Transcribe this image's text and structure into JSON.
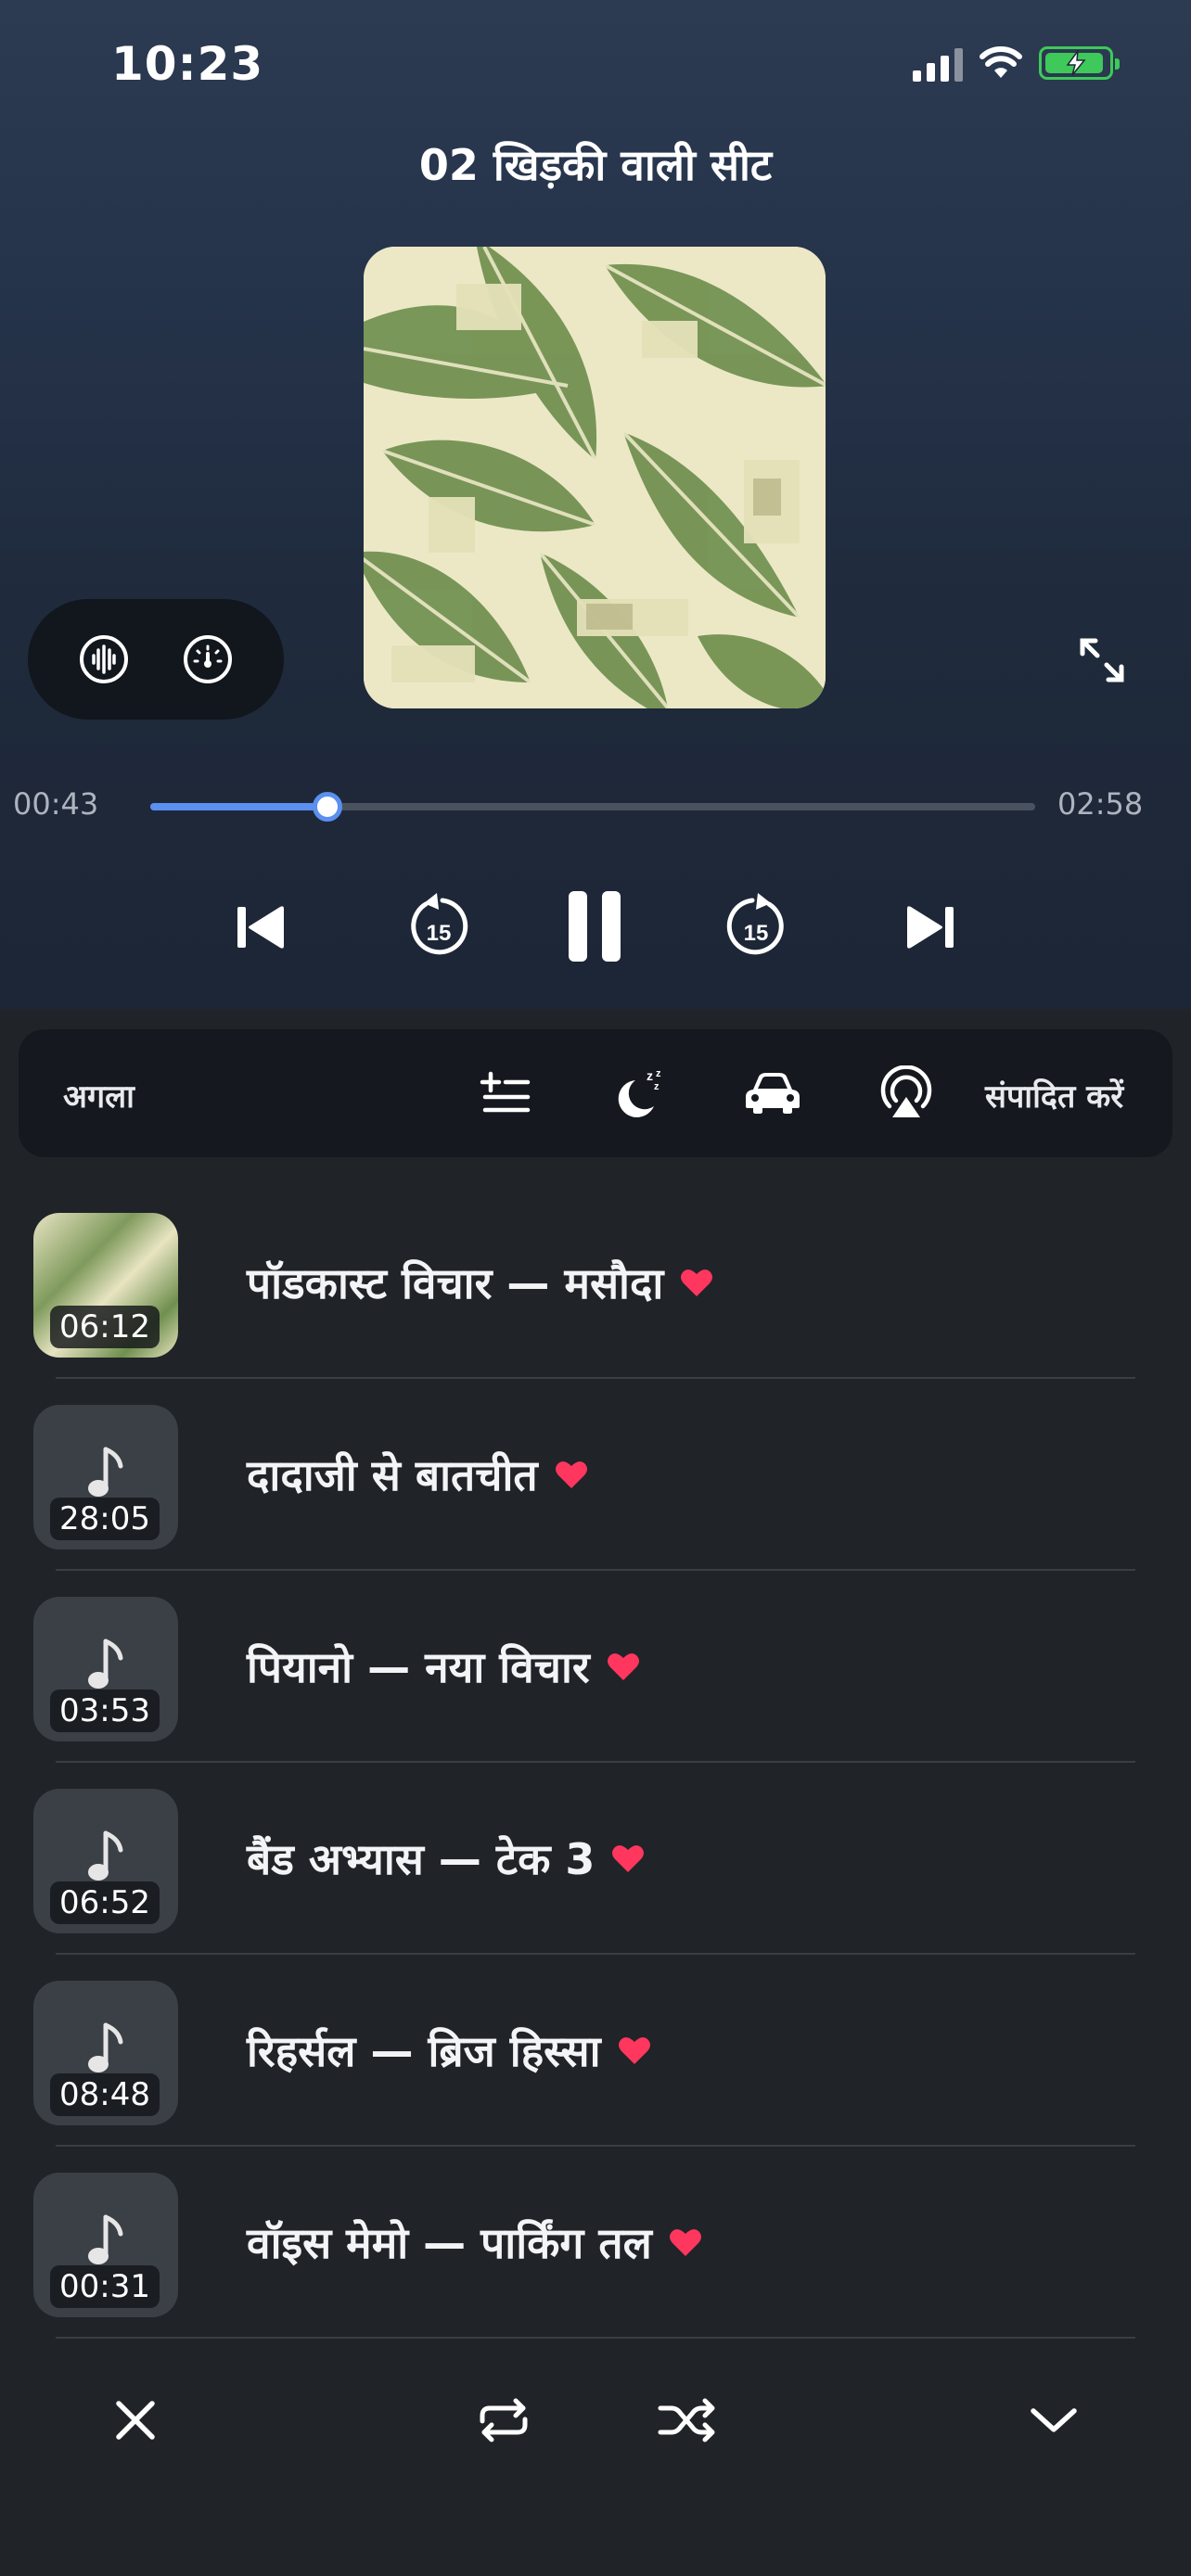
{
  "status_bar": {
    "time": "10:23",
    "battery_color": "#3ec95a"
  },
  "player": {
    "title": "02 खिड़की वाली सीट",
    "current_time": "00:43",
    "total_time": "02:58",
    "progress_fraction": 0.2,
    "accent_color": "#5b8ff0",
    "pill_buttons": [
      "waveform-icon",
      "speed-gauge-icon"
    ],
    "skip_back_seconds": "15",
    "skip_forward_seconds": "15"
  },
  "queue": {
    "label": "अगला",
    "edit_label": "संपादित करें",
    "icons": [
      "add-to-list-icon",
      "sleep-timer-icon",
      "car-icon",
      "airplay-icon"
    ]
  },
  "tracks": [
    {
      "title": "पॉडकास्ट विचार — मसौदा",
      "duration": "06:12",
      "favorite": true,
      "has_artwork": true
    },
    {
      "title": "दादाजी से बातचीत",
      "duration": "28:05",
      "favorite": true,
      "has_artwork": false
    },
    {
      "title": "पियानो — नया विचार",
      "duration": "03:53",
      "favorite": true,
      "has_artwork": false
    },
    {
      "title": "बैंड अभ्यास — टेक 3",
      "duration": "06:52",
      "favorite": true,
      "has_artwork": false
    },
    {
      "title": "रिहर्सल — ब्रिज हिस्सा",
      "duration": "08:48",
      "favorite": true,
      "has_artwork": false
    },
    {
      "title": "वॉइस मेमो — पार्किंग तल",
      "duration": "00:31",
      "favorite": true,
      "has_artwork": false
    }
  ],
  "heart_color": "#ff375f",
  "bottom_bar": {
    "icons": [
      "close-icon",
      "repeat-icon",
      "shuffle-icon",
      "chevron-down-icon"
    ]
  }
}
